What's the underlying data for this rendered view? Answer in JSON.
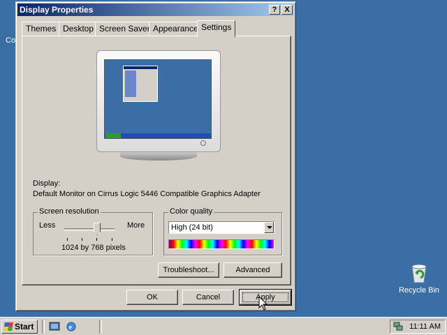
{
  "window": {
    "title": "Display Properties",
    "help_btn": "?",
    "close_btn": "X"
  },
  "tabs": [
    {
      "label": "Themes"
    },
    {
      "label": "Desktop"
    },
    {
      "label": "Screen Saver"
    },
    {
      "label": "Appearance"
    },
    {
      "label": "Settings"
    }
  ],
  "active_tab": "Settings",
  "display": {
    "label": "Display:",
    "value": "Default Monitor on Cirrus Logic 5446 Compatible Graphics Adapter"
  },
  "resolution": {
    "group_label": "Screen resolution",
    "less": "Less",
    "more": "More",
    "value": "1024 by 768 pixels"
  },
  "color_quality": {
    "group_label": "Color quality",
    "selected": "High (24 bit)"
  },
  "buttons": {
    "troubleshoot": "Troubleshoot...",
    "advanced": "Advanced",
    "ok": "OK",
    "cancel": "Cancel",
    "apply": "Apply"
  },
  "desktop": {
    "recycle_bin": "Recycle Bin",
    "partial_icon_label": "Co"
  },
  "taskbar": {
    "start": "Start",
    "clock": "11:11 AM"
  },
  "colors": {
    "desktop": "#3a6ea5",
    "title_start": "#0a246a",
    "title_end": "#a6caf0",
    "face": "#d4d0c8"
  }
}
